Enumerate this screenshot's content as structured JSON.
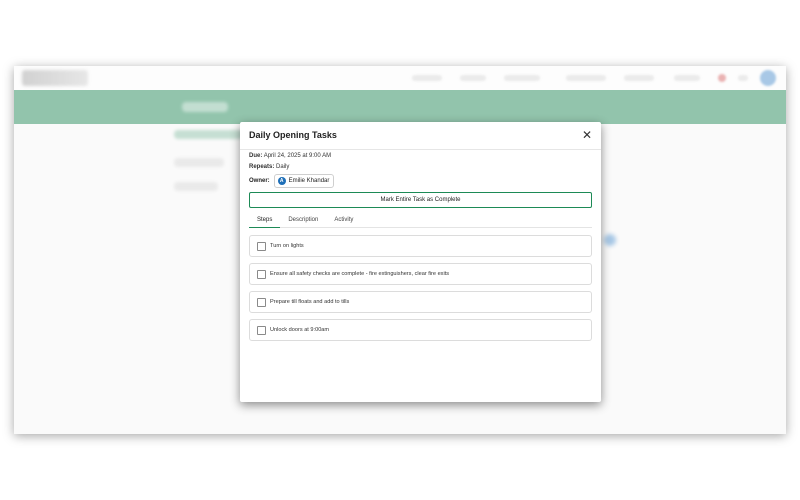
{
  "modal": {
    "title": "Daily Opening Tasks",
    "close_icon": "close-icon",
    "due_label": "Due:",
    "due_value": "April 24, 2025 at 9:00 AM",
    "repeats_label": "Repeats:",
    "repeats_value": "Daily",
    "owner_label": "Owner:",
    "owner_initial": "A",
    "owner_name": "Emilie Khandar",
    "complete_button": "Mark Entire Task as Complete",
    "tabs": [
      {
        "label": "Steps",
        "active": true
      },
      {
        "label": "Description",
        "active": false
      },
      {
        "label": "Activity",
        "active": false
      }
    ],
    "steps": [
      {
        "label": "Turn on lights",
        "checked": false
      },
      {
        "label": "Ensure all safety checks are complete - fire extinguishers, clear fire exits",
        "checked": false
      },
      {
        "label": "Prepare till floats and add to tills",
        "checked": false
      },
      {
        "label": "Unlock doors at 9:00am",
        "checked": false
      }
    ]
  },
  "colors": {
    "brand_green": "#0e7d48",
    "accent_green": "#1d8a56",
    "avatar_blue": "#1e6fb8"
  }
}
